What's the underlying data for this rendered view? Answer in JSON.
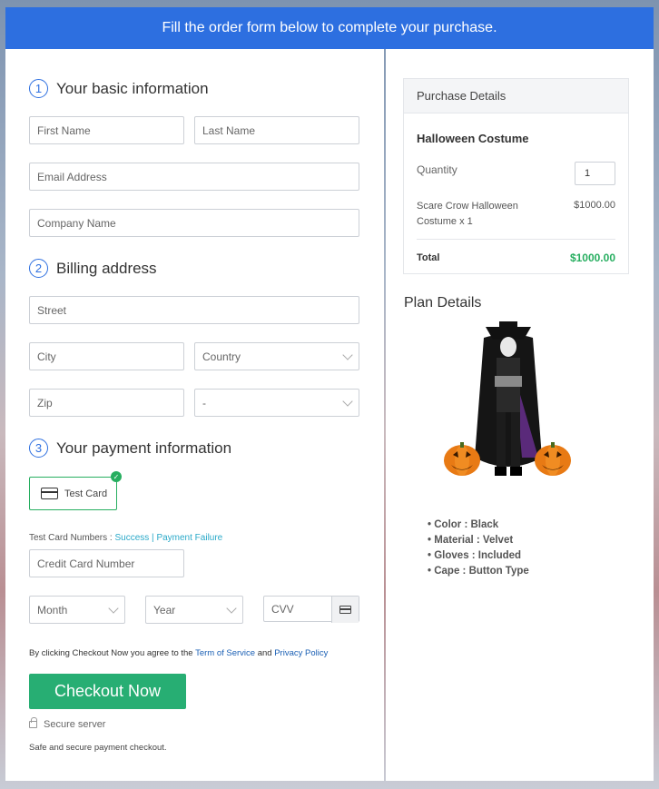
{
  "banner": "Fill the order form below to complete your purchase.",
  "basic": {
    "num": "1",
    "title": "Your basic information",
    "first_name": "First Name",
    "last_name": "Last Name",
    "email": "Email Address",
    "company": "Company Name"
  },
  "billing": {
    "num": "2",
    "title": "Billing address",
    "street": "Street",
    "city": "City",
    "country": "Country",
    "zip": "Zip",
    "state": "-"
  },
  "payment": {
    "num": "3",
    "title": "Your payment information",
    "card_option": "Test Card",
    "test_numbers_label": "Test Card Numbers : ",
    "success": "Success",
    "sep": " | ",
    "failure": "Payment Failure",
    "card_number": "Credit Card Number",
    "month": "Month",
    "year": "Year",
    "cvv": "CVV"
  },
  "terms": {
    "prefix": "By clicking Checkout Now you agree to the ",
    "tos": "Term of Service",
    "and": " and ",
    "privacy": "Privacy Policy"
  },
  "checkout_label": "Checkout Now",
  "secure": "Secure server",
  "safe": "Safe and secure payment checkout.",
  "purchase": {
    "heading": "Purchase Details",
    "product": "Halloween Costume",
    "qty_label": "Quantity",
    "qty": "1",
    "item_name": "Scare Crow Halloween Costume x 1",
    "item_price": "$1000.00",
    "total_label": "Total",
    "total": "$1000.00"
  },
  "plan": {
    "heading": "Plan Details",
    "items": [
      "Color : Black",
      "Material : Velvet",
      "Gloves : Included",
      "Cape : Button Type"
    ]
  },
  "colors": {
    "accent": "#2d6fe0",
    "success": "#27ae73",
    "total_green": "#27ae60"
  }
}
